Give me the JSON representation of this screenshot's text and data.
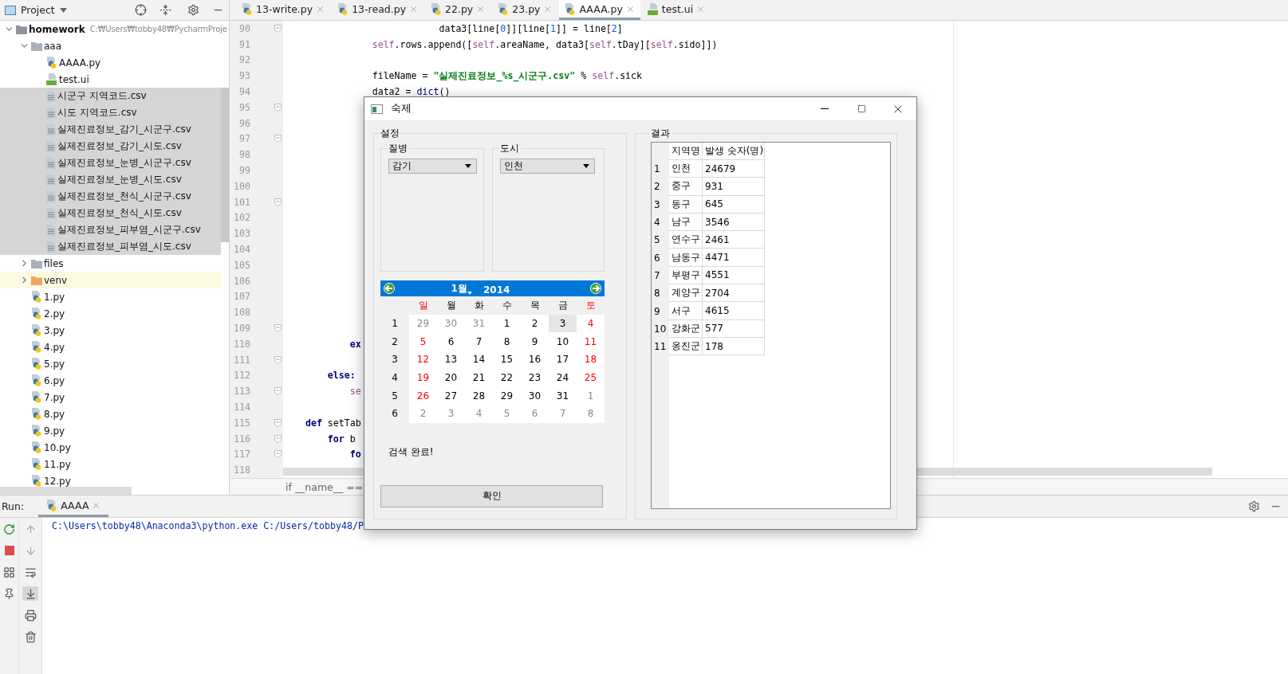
{
  "ide": {
    "project": {
      "title": "Project",
      "tree": [
        {
          "label": "homework",
          "path": "C:₩Users₩tobby48₩PycharmProje",
          "kind": "module",
          "expanded": true,
          "selected": false,
          "highlighted": false,
          "children": [
            {
              "label": "aaa",
              "kind": "folder",
              "expanded": true,
              "selected": false,
              "highlighted": false,
              "children": [
                {
                  "label": "AAAA.py",
                  "kind": "python",
                  "selected": false,
                  "highlighted": false
                },
                {
                  "label": "test.ui",
                  "kind": "qt",
                  "selected": false,
                  "highlighted": false
                },
                {
                  "label": "시군구 지역코드.csv",
                  "kind": "csv",
                  "selected": true,
                  "highlighted": false
                },
                {
                  "label": "시도 지역코드.csv",
                  "kind": "csv",
                  "selected": true,
                  "highlighted": false
                },
                {
                  "label": "실제진료정보_감기_시군구.csv",
                  "kind": "csv",
                  "selected": true,
                  "highlighted": false
                },
                {
                  "label": "실제진료정보_감기_시도.csv",
                  "kind": "csv",
                  "selected": true,
                  "highlighted": false
                },
                {
                  "label": "실제진료정보_눈병_시군구.csv",
                  "kind": "csv",
                  "selected": true,
                  "highlighted": false
                },
                {
                  "label": "실제진료정보_눈병_시도.csv",
                  "kind": "csv",
                  "selected": true,
                  "highlighted": false
                },
                {
                  "label": "실제진료정보_천식_시군구.csv",
                  "kind": "csv",
                  "selected": true,
                  "highlighted": false
                },
                {
                  "label": "실제진료정보_천식_시도.csv",
                  "kind": "csv",
                  "selected": true,
                  "highlighted": false
                },
                {
                  "label": "실제진료정보_피부염_시군구.csv",
                  "kind": "csv",
                  "selected": true,
                  "highlighted": false
                },
                {
                  "label": "실제진료정보_피부염_시도.csv",
                  "kind": "csv",
                  "selected": true,
                  "highlighted": false
                }
              ]
            },
            {
              "label": "files",
              "kind": "folder",
              "expanded": false,
              "selected": false,
              "highlighted": false
            },
            {
              "label": "venv",
              "kind": "excluded-folder",
              "expanded": false,
              "selected": false,
              "highlighted": true
            },
            {
              "label": "1.py",
              "kind": "python",
              "selected": false,
              "highlighted": false
            },
            {
              "label": "2.py",
              "kind": "python",
              "selected": false,
              "highlighted": false
            },
            {
              "label": "3.py",
              "kind": "python",
              "selected": false,
              "highlighted": false
            },
            {
              "label": "4.py",
              "kind": "python",
              "selected": false,
              "highlighted": false
            },
            {
              "label": "5.py",
              "kind": "python",
              "selected": false,
              "highlighted": false
            },
            {
              "label": "6.py",
              "kind": "python",
              "selected": false,
              "highlighted": false
            },
            {
              "label": "7.py",
              "kind": "python",
              "selected": false,
              "highlighted": false
            },
            {
              "label": "8.py",
              "kind": "python",
              "selected": false,
              "highlighted": false
            },
            {
              "label": "9.py",
              "kind": "python",
              "selected": false,
              "highlighted": false
            },
            {
              "label": "10.py",
              "kind": "python",
              "selected": false,
              "highlighted": false
            },
            {
              "label": "11.py",
              "kind": "python",
              "selected": false,
              "highlighted": false
            },
            {
              "label": "12.py",
              "kind": "python",
              "selected": false,
              "highlighted": false
            }
          ]
        }
      ]
    },
    "editor": {
      "tabs": [
        {
          "label": "13-write.py",
          "kind": "python",
          "selected": false
        },
        {
          "label": "13-read.py",
          "kind": "python",
          "selected": false
        },
        {
          "label": "22.py",
          "kind": "python",
          "selected": false
        },
        {
          "label": "23.py",
          "kind": "python",
          "selected": false
        },
        {
          "label": "AAAA.py",
          "kind": "python",
          "selected": true
        },
        {
          "label": "test.ui",
          "kind": "qt",
          "selected": false
        }
      ],
      "lines": [
        {
          "number": "90",
          "fold": true,
          "tokens": [
            {
              "text": "                            data3[line[",
              "kind": "plain"
            },
            {
              "text": "0",
              "kind": "number"
            },
            {
              "text": "]][line[",
              "kind": "plain"
            },
            {
              "text": "1",
              "kind": "number"
            },
            {
              "text": "]] = line[",
              "kind": "plain"
            },
            {
              "text": "2",
              "kind": "number"
            },
            {
              "text": "]",
              "kind": "plain"
            }
          ]
        },
        {
          "number": "91",
          "fold": false,
          "tokens": [
            {
              "text": "                self",
              "kind": "self"
            },
            {
              "text": ".rows.append([",
              "kind": "plain"
            },
            {
              "text": "self",
              "kind": "self"
            },
            {
              "text": ".areaName, data3[",
              "kind": "plain"
            },
            {
              "text": "self",
              "kind": "self"
            },
            {
              "text": ".tDay][",
              "kind": "plain"
            },
            {
              "text": "self",
              "kind": "self"
            },
            {
              "text": ".sido]])",
              "kind": "plain"
            }
          ]
        },
        {
          "number": "92",
          "fold": false
        },
        {
          "number": "93",
          "fold": false,
          "tokens": [
            {
              "text": "                fileName = ",
              "kind": "plain"
            },
            {
              "text": "\"실제진료정보_%s_시군구.csv\"",
              "kind": "string"
            },
            {
              "text": " % ",
              "kind": "plain"
            },
            {
              "text": "self",
              "kind": "self"
            },
            {
              "text": ".sick",
              "kind": "plain"
            }
          ]
        },
        {
          "number": "94",
          "fold": false,
          "tokens": [
            {
              "text": "                data2 = ",
              "kind": "plain"
            },
            {
              "text": "dict",
              "kind": "builtin"
            },
            {
              "text": "()",
              "kind": "plain"
            }
          ]
        },
        {
          "number": "95",
          "fold": true
        },
        {
          "number": "96",
          "fold": false
        },
        {
          "number": "97",
          "fold": true
        },
        {
          "number": "98",
          "fold": false
        },
        {
          "number": "99",
          "fold": false
        },
        {
          "number": "100",
          "fold": false
        },
        {
          "number": "101",
          "fold": true
        },
        {
          "number": "102",
          "fold": false
        },
        {
          "number": "103",
          "fold": false
        },
        {
          "number": "104",
          "fold": false
        },
        {
          "number": "105",
          "fold": false
        },
        {
          "number": "106",
          "fold": false
        },
        {
          "number": "107",
          "fold": false
        },
        {
          "number": "108",
          "fold": false
        },
        {
          "number": "109",
          "fold": true
        },
        {
          "number": "110",
          "fold": false,
          "tokens": [
            {
              "text": "            ex",
              "kind": "keyword"
            }
          ]
        },
        {
          "number": "111",
          "fold": true
        },
        {
          "number": "112",
          "fold": false,
          "tokens": [
            {
              "text": "        else:",
              "kind": "keyword"
            }
          ]
        },
        {
          "number": "113",
          "fold": true,
          "tokens": [
            {
              "text": "            se",
              "kind": "self"
            }
          ]
        },
        {
          "number": "114",
          "fold": false
        },
        {
          "number": "115",
          "fold": true,
          "tokens": [
            {
              "text": "    def",
              "kind": "keyword"
            },
            {
              "text": " setTab",
              "kind": "plain"
            }
          ]
        },
        {
          "number": "116",
          "fold": true,
          "tokens": [
            {
              "text": "        for",
              "kind": "keyword"
            },
            {
              "text": " b",
              "kind": "plain"
            }
          ]
        },
        {
          "number": "117",
          "fold": true,
          "tokens": [
            {
              "text": "            fo",
              "kind": "keyword"
            }
          ]
        },
        {
          "number": "118",
          "fold": false
        }
      ],
      "breadcrumb": "if __name__ =="
    },
    "run": {
      "label": "Run:",
      "tabs": [
        {
          "label": "AAAA",
          "selected": true
        }
      ],
      "tools": [
        {
          "kind": "rerun",
          "on": false
        },
        {
          "kind": "stop",
          "on": false
        },
        {
          "kind": "layout",
          "on": false
        },
        {
          "kind": "pin",
          "on": false
        }
      ],
      "tools_2": [
        {
          "kind": "up",
          "on": false
        },
        {
          "kind": "down",
          "on": false
        },
        {
          "kind": "wrap",
          "on": false
        },
        {
          "kind": "scroll-end",
          "on": true
        },
        {
          "kind": "print",
          "on": false
        },
        {
          "kind": "trash",
          "on": false
        }
      ],
      "console": [
        "C:\\Users\\tobby48\\Anaconda3\\python.exe C:/Users/tobby48/P"
      ]
    }
  },
  "dialog": {
    "title": "숙제",
    "settings": {
      "title": "설정",
      "disease": {
        "title": "질병",
        "value": "감기"
      },
      "city": {
        "title": "도시",
        "value": "인천"
      },
      "calendar": {
        "month": "1월",
        "year": "2014",
        "weekdays": [
          "일",
          "월",
          "화",
          "수",
          "목",
          "금",
          "토"
        ],
        "weeks": [
          {
            "number": "1",
            "days": [
              {
                "day": "29",
                "kind": "other",
                "selected": false
              },
              {
                "day": "30",
                "kind": "other",
                "selected": false
              },
              {
                "day": "31",
                "kind": "other",
                "selected": false
              },
              {
                "day": "1",
                "kind": "current",
                "selected": false
              },
              {
                "day": "2",
                "kind": "current",
                "selected": false
              },
              {
                "day": "3",
                "kind": "current",
                "selected": true
              },
              {
                "day": "4",
                "kind": "current",
                "selected": false
              }
            ]
          },
          {
            "number": "2",
            "days": [
              {
                "day": "5",
                "kind": "current",
                "selected": false
              },
              {
                "day": "6",
                "kind": "current",
                "selected": false
              },
              {
                "day": "7",
                "kind": "current",
                "selected": false
              },
              {
                "day": "8",
                "kind": "current",
                "selected": false
              },
              {
                "day": "9",
                "kind": "current",
                "selected": false
              },
              {
                "day": "10",
                "kind": "current",
                "selected": false
              },
              {
                "day": "11",
                "kind": "current",
                "selected": false
              }
            ]
          },
          {
            "number": "3",
            "days": [
              {
                "day": "12",
                "kind": "current",
                "selected": false
              },
              {
                "day": "13",
                "kind": "current",
                "selected": false
              },
              {
                "day": "14",
                "kind": "current",
                "selected": false
              },
              {
                "day": "15",
                "kind": "current",
                "selected": false
              },
              {
                "day": "16",
                "kind": "current",
                "selected": false
              },
              {
                "day": "17",
                "kind": "current",
                "selected": false
              },
              {
                "day": "18",
                "kind": "current",
                "selected": false
              }
            ]
          },
          {
            "number": "4",
            "days": [
              {
                "day": "19",
                "kind": "current",
                "selected": false
              },
              {
                "day": "20",
                "kind": "current",
                "selected": false
              },
              {
                "day": "21",
                "kind": "current",
                "selected": false
              },
              {
                "day": "22",
                "kind": "current",
                "selected": false
              },
              {
                "day": "23",
                "kind": "current",
                "selected": false
              },
              {
                "day": "24",
                "kind": "current",
                "selected": false
              },
              {
                "day": "25",
                "kind": "current",
                "selected": false
              }
            ]
          },
          {
            "number": "5",
            "days": [
              {
                "day": "26",
                "kind": "current",
                "selected": false
              },
              {
                "day": "27",
                "kind": "current",
                "selected": false
              },
              {
                "day": "28",
                "kind": "current",
                "selected": false
              },
              {
                "day": "29",
                "kind": "current",
                "selected": false
              },
              {
                "day": "30",
                "kind": "current",
                "selected": false
              },
              {
                "day": "31",
                "kind": "current",
                "selected": false
              },
              {
                "day": "1",
                "kind": "other",
                "selected": false
              }
            ]
          },
          {
            "number": "6",
            "days": [
              {
                "day": "2",
                "kind": "other",
                "selected": false
              },
              {
                "day": "3",
                "kind": "other",
                "selected": false
              },
              {
                "day": "4",
                "kind": "other",
                "selected": false
              },
              {
                "day": "5",
                "kind": "other",
                "selected": false
              },
              {
                "day": "6",
                "kind": "other",
                "selected": false
              },
              {
                "day": "7",
                "kind": "other",
                "selected": false
              },
              {
                "day": "8",
                "kind": "other",
                "selected": false
              }
            ]
          }
        ]
      },
      "status": "검색 완료!",
      "button": "확인"
    },
    "results": {
      "title": "결과",
      "columns": [
        "지역명",
        "발생 숫자(명)"
      ],
      "rows": [
        {
          "number": "1",
          "cells": [
            "인천",
            "24679"
          ]
        },
        {
          "number": "2",
          "cells": [
            "중구",
            "931"
          ]
        },
        {
          "number": "3",
          "cells": [
            "동구",
            "645"
          ]
        },
        {
          "number": "4",
          "cells": [
            "남구",
            "3546"
          ]
        },
        {
          "number": "5",
          "cells": [
            "연수구",
            "2461"
          ]
        },
        {
          "number": "6",
          "cells": [
            "남동구",
            "4471"
          ]
        },
        {
          "number": "7",
          "cells": [
            "부평구",
            "4551"
          ]
        },
        {
          "number": "8",
          "cells": [
            "계양구",
            "2704"
          ]
        },
        {
          "number": "9",
          "cells": [
            "서구",
            "4615"
          ]
        },
        {
          "number": "10",
          "cells": [
            "강화군",
            "577"
          ]
        },
        {
          "number": "11",
          "cells": [
            "옹진군",
            "178"
          ]
        }
      ]
    }
  }
}
